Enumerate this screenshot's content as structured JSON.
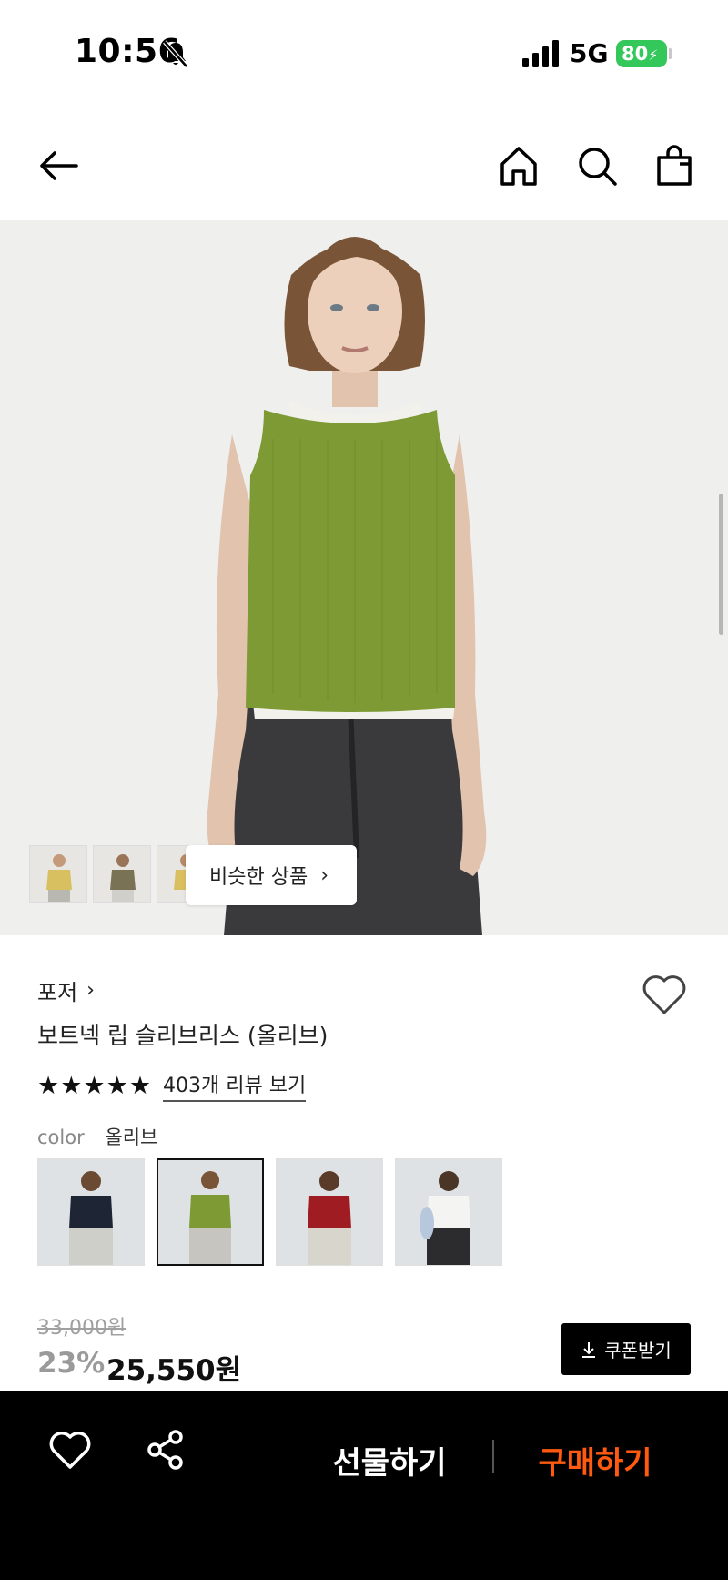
{
  "status_bar": {
    "time": "10:56",
    "network": "5G",
    "battery": "80",
    "icons": [
      "bell-slash-icon",
      "signal-icon",
      "battery-icon"
    ]
  },
  "nav": {
    "icons": [
      "back-arrow-icon",
      "home-icon",
      "search-icon",
      "shopping-bag-icon"
    ]
  },
  "hero": {
    "similar_products_label": "비슷한 상품",
    "thumbnail_count": 3
  },
  "product": {
    "brand": "포저",
    "title": "보트넥 립 슬리브리스 (올리브)",
    "rating_stars": "★★★★★",
    "rating": 5,
    "reviews_link": "403개 리뷰 보기",
    "color_label": "color",
    "color_value": "올리브",
    "swatches": [
      {
        "color": "navy",
        "hex": "#1e2535",
        "selected": false
      },
      {
        "color": "olive",
        "hex": "#7d9a34",
        "selected": true
      },
      {
        "color": "red",
        "hex": "#9f1c23",
        "selected": false
      },
      {
        "color": "white",
        "hex": "#f4f4f2",
        "selected": false
      }
    ],
    "original_price": "33,000원",
    "discount": "23%",
    "sale_price": "25,550원",
    "coupon_label": "쿠폰받기"
  },
  "bottom_bar": {
    "gift_label": "선물하기",
    "buy_label": "구매하기",
    "icons": [
      "heart-icon",
      "share-icon"
    ]
  },
  "colors": {
    "accent": "#ff5a0f",
    "battery": "#34c759",
    "bottom_bar_bg": "#000000"
  }
}
